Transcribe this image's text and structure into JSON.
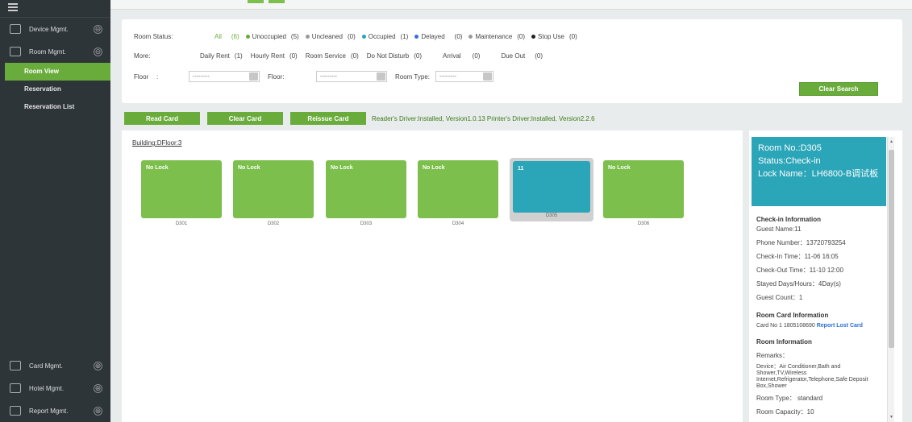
{
  "sidebar": {
    "groups_top": [
      {
        "label": "Device Mgmt.",
        "toggle": "⊖"
      },
      {
        "label": "Room Mgmt.",
        "toggle": "⊖"
      }
    ],
    "items": [
      {
        "label": "Room View"
      },
      {
        "label": "Reservation"
      },
      {
        "label": "Reservation List"
      }
    ],
    "groups_bottom": [
      {
        "label": "Card Mgmt.",
        "toggle": "⊕"
      },
      {
        "label": "Hotel Mgmt.",
        "toggle": "⊕"
      },
      {
        "label": "Report Mgmt.",
        "toggle": "⊕"
      }
    ]
  },
  "filters": {
    "room_status_label": "Room Status:",
    "all_label": "All",
    "all_count": "(6)",
    "statuses": [
      {
        "label": "Unoccupied",
        "count": "(5)",
        "color": "#6aac3c"
      },
      {
        "label": "Uncleaned",
        "count": "(0)",
        "color": "#999999"
      },
      {
        "label": "Occupied",
        "count": "(1)",
        "color": "#2ba5b8"
      },
      {
        "label": "Delayed",
        "count": "(0)",
        "color": "#3b6fd6"
      },
      {
        "label": "Maintenance",
        "count": "(0)",
        "color": "#9a9a9a"
      },
      {
        "label": "Stop Use",
        "count": "(0)",
        "color": "#222222"
      }
    ],
    "more_label": "More:",
    "more": [
      {
        "label": "Daily Rent",
        "count": "(1)"
      },
      {
        "label": "Hourly Rent",
        "count": "(0)"
      },
      {
        "label": "Room Service",
        "count": "(0)"
      },
      {
        "label": "Do Not Disturb",
        "count": "(0)"
      },
      {
        "label": "Arrival",
        "count": "(0)"
      },
      {
        "label": "Due Out",
        "count": "(0)"
      }
    ],
    "floor1_label": "Floor",
    "floor1_colon": ":",
    "floor1_value": "---------",
    "floor2_label": "Floor:",
    "floor2_value": "---------",
    "room_type_label": "Room Type:",
    "room_type_value": "---------",
    "clear_search": "Clear Search"
  },
  "actions": {
    "read_card": "Read Card",
    "clear_card": "Clear Card",
    "reissue_card": "Reissue Card",
    "driver_text": "Reader's Driver:Installed, Version1.0.13 Printer's Driver:Installed, Version2.2.6"
  },
  "rooms": {
    "building": "Building:DFloor:3",
    "list": [
      {
        "tile": "No Lock",
        "number": "D301"
      },
      {
        "tile": "No Lock",
        "number": "D302"
      },
      {
        "tile": "No Lock",
        "number": "D303"
      },
      {
        "tile": "No Lock",
        "number": "D304"
      },
      {
        "tile": "11",
        "number": "D305",
        "selected": true
      },
      {
        "tile": "No Lock",
        "number": "D306"
      }
    ]
  },
  "detail": {
    "room_no": "Room No.:D305",
    "status": "Status:Check-in",
    "lock_name": "Lock Name：LH6800-B调试板",
    "checkin_title": "Check-in Information",
    "guest_name": "Guest Name:11",
    "phone": "Phone Number：13720793254",
    "checkin_time": "Check-In Time：11-06 16:05",
    "checkout_time": "Check-Out Time：11-10 12:00",
    "stayed": "Stayed Days/Hours：4Day(s)",
    "guest_count": "Guest Count：1",
    "card_title": "Room Card Information",
    "card_no": "Card No 1 1805108690",
    "report_lost": "Report Lost Card",
    "room_info_title": "Room Information",
    "remarks": "Remarks：",
    "device": "Device：Air Conditioner,Bath and Shower,TV,Wireless Internet,Refrigerator,Telephone,Safe Deposit Box,Shower",
    "room_type": "Room Type： standard",
    "room_capacity": "Room Capacity：10"
  }
}
